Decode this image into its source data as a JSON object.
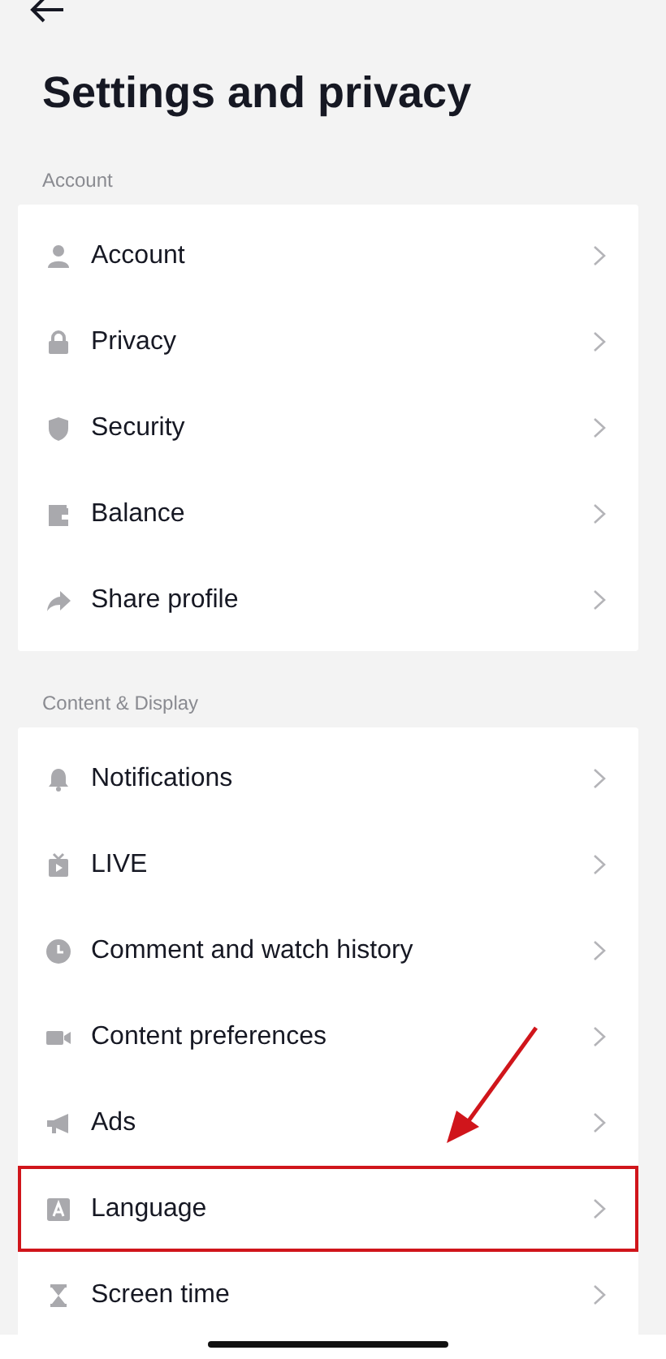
{
  "header": {
    "title": "Settings and privacy"
  },
  "sections": [
    {
      "label": "Account",
      "items": [
        {
          "kind": "person",
          "label": "Account",
          "highlighted": false
        },
        {
          "kind": "lock",
          "label": "Privacy",
          "highlighted": false
        },
        {
          "kind": "shield",
          "label": "Security",
          "highlighted": false
        },
        {
          "kind": "wallet",
          "label": "Balance",
          "highlighted": false
        },
        {
          "kind": "share",
          "label": "Share profile",
          "highlighted": false
        }
      ]
    },
    {
      "label": "Content & Display",
      "items": [
        {
          "kind": "bell",
          "label": "Notifications",
          "highlighted": false
        },
        {
          "kind": "tv",
          "label": "LIVE",
          "highlighted": false
        },
        {
          "kind": "clock",
          "label": "Comment and watch history",
          "highlighted": false
        },
        {
          "kind": "camera",
          "label": "Content preferences",
          "highlighted": false
        },
        {
          "kind": "megaphone",
          "label": "Ads",
          "highlighted": false
        },
        {
          "kind": "letter",
          "label": "Language",
          "highlighted": true
        },
        {
          "kind": "hourglass",
          "label": "Screen time",
          "highlighted": false
        }
      ]
    }
  ]
}
